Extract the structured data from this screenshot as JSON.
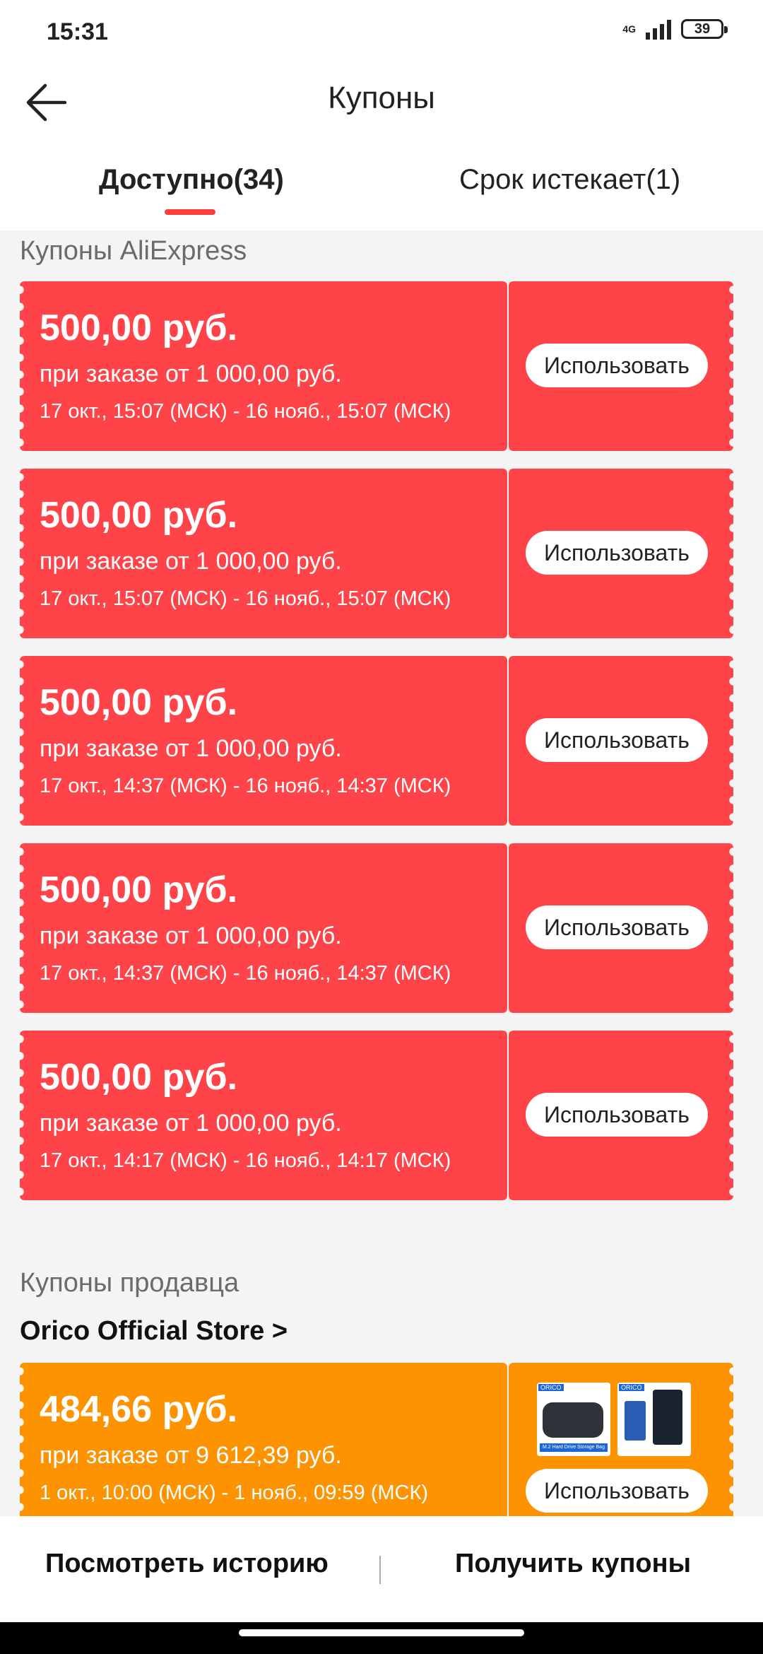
{
  "status_bar": {
    "time": "15:31",
    "network": "4G",
    "battery": "39"
  },
  "header": {
    "title": "Купоны"
  },
  "tabs": [
    {
      "label": "Доступно(34)",
      "active": true
    },
    {
      "label": "Срок истекает(1)",
      "active": false
    }
  ],
  "sections": {
    "aliexpress_title": "Купоны AliExpress",
    "seller_title": "Купоны продавца",
    "store_link": "Orico Official Store >"
  },
  "coupons": [
    {
      "amount": "500,00 руб.",
      "condition": "при заказе от 1 000,00 руб.",
      "validity": "17 окт., 15:07 (МСК) - 16 нояб., 15:07 (МСК)",
      "button": "Использовать"
    },
    {
      "amount": "500,00 руб.",
      "condition": "при заказе от 1 000,00 руб.",
      "validity": "17 окт., 15:07 (МСК) - 16 нояб., 15:07 (МСК)",
      "button": "Использовать"
    },
    {
      "amount": "500,00 руб.",
      "condition": "при заказе от 1 000,00 руб.",
      "validity": "17 окт., 14:37 (МСК) - 16 нояб., 14:37 (МСК)",
      "button": "Использовать"
    },
    {
      "amount": "500,00 руб.",
      "condition": "при заказе от 1 000,00 руб.",
      "validity": "17 окт., 14:37 (МСК) - 16 нояб., 14:37 (МСК)",
      "button": "Использовать"
    },
    {
      "amount": "500,00 руб.",
      "condition": "при заказе от 1 000,00 руб.",
      "validity": "17 окт., 14:17 (МСК) - 16 нояб., 14:17 (МСК)",
      "button": "Использовать"
    }
  ],
  "seller_coupon": {
    "amount": "484,66 руб.",
    "condition": "при заказе от 9 612,39 руб.",
    "validity": "1 окт., 10:00 (МСК) - 1 нояб., 09:59 (МСК)",
    "button": "Использовать",
    "product_brand": "ORICO",
    "product_caption": "M.2 Hard Drive Storage Bag"
  },
  "bottom_bar": {
    "history": "Посмотреть историю",
    "separator": "|",
    "get_coupons": "Получить купоны"
  },
  "colors": {
    "coupon_red": "#fe4349",
    "coupon_orange": "#fd9300",
    "accent": "#ff3d3d"
  }
}
